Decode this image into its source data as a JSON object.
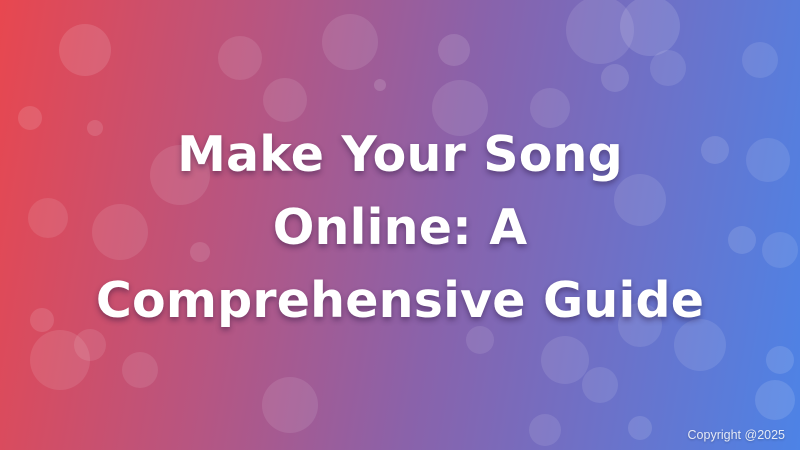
{
  "banner": {
    "title_lines": [
      "Make Your Song",
      "Online: A",
      "Comprehensive Guide"
    ],
    "copyright": "Copyright @2025"
  },
  "colors": {
    "gradient_start": "#e8474f",
    "gradient_mid": "#8a62aa",
    "gradient_end": "#4d83e6",
    "text": "#ffffff"
  }
}
